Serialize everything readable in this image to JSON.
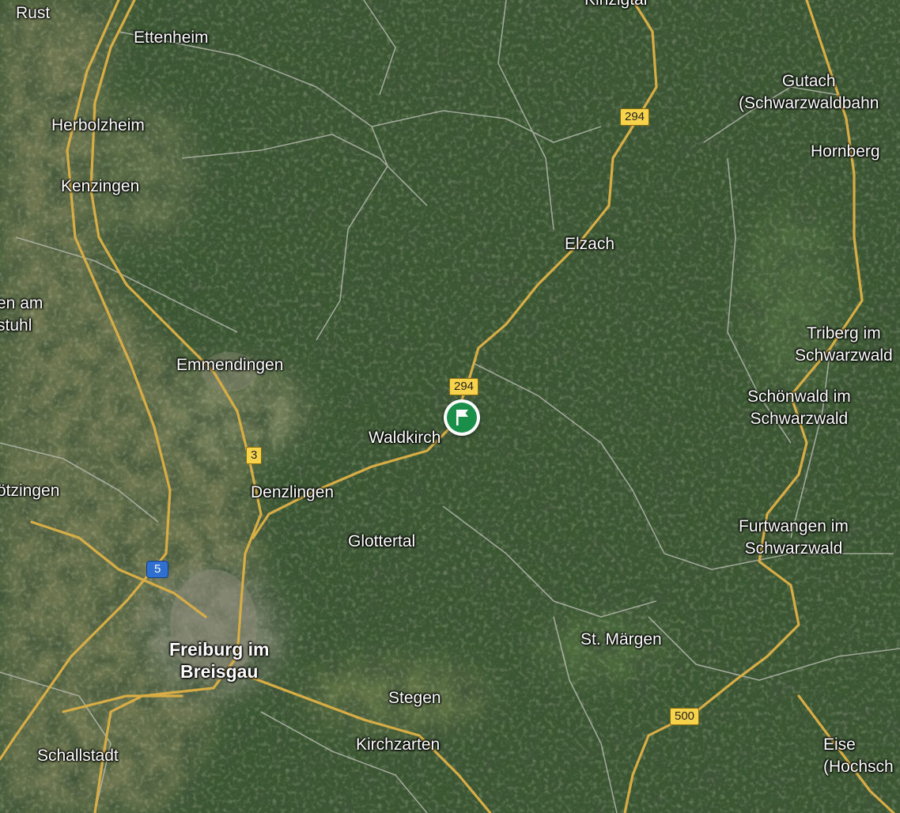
{
  "map": {
    "type": "satellite",
    "region": "Black Forest",
    "colors": {
      "forest_dark": "#20351f",
      "forest": "#3c5a34",
      "farmland": "#6f7a52",
      "road_major": "#e2b54a",
      "road_minor": "#b8b8b0",
      "marker": "#1a8f4a"
    }
  },
  "places": [
    {
      "id": "rust",
      "label": "Rust"
    },
    {
      "id": "ettenheim",
      "label": "Ettenheim"
    },
    {
      "id": "kinzigtal",
      "label": "Kinzigtal"
    },
    {
      "id": "herbolzheim",
      "label": "Herbolzheim"
    },
    {
      "id": "kenzingen",
      "label": "Kenzingen"
    },
    {
      "id": "gutach",
      "label": "Gutach",
      "label2": "(Schwarzwaldbahn"
    },
    {
      "id": "hornberg",
      "label": "Hornberg"
    },
    {
      "id": "elzach",
      "label": "Elzach"
    },
    {
      "id": "endingen",
      "label": "en am",
      "label2": "stuhl"
    },
    {
      "id": "triberg",
      "label": "Triberg im",
      "label2": "Schwarzwald"
    },
    {
      "id": "emmendingen",
      "label": "Emmendingen"
    },
    {
      "id": "schoenwald",
      "label": "Schönwald im",
      "label2": "Schwarzwald"
    },
    {
      "id": "waldkirch",
      "label": "Waldkirch"
    },
    {
      "id": "gottenheim",
      "label": "ötzingen"
    },
    {
      "id": "denzlingen",
      "label": "Denzlingen"
    },
    {
      "id": "furtwangen",
      "label": "Furtwangen im",
      "label2": "Schwarzwald"
    },
    {
      "id": "glottertal",
      "label": "Glottertal"
    },
    {
      "id": "stmaergen",
      "label": "St. Märgen"
    },
    {
      "id": "freiburg",
      "label": "Freiburg im",
      "label2": "Breisgau"
    },
    {
      "id": "stegen",
      "label": "Stegen"
    },
    {
      "id": "schallstadt",
      "label": "Schallstadt"
    },
    {
      "id": "kirchzarten",
      "label": "Kirchzarten"
    },
    {
      "id": "eisenbach",
      "label": "Eise",
      "label2": "(Hochsch"
    }
  ],
  "shields": [
    {
      "id": "b294-north",
      "label": "294"
    },
    {
      "id": "b294-waldkirch",
      "label": "294"
    },
    {
      "id": "b3",
      "label": "3"
    },
    {
      "id": "a5",
      "label": "5"
    },
    {
      "id": "b500",
      "label": "500"
    }
  ],
  "marker": {
    "icon": "flag-icon",
    "near": "Waldkirch"
  }
}
